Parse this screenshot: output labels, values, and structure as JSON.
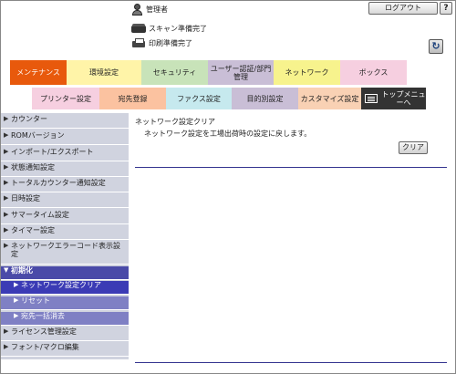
{
  "header": {
    "user_label": "管理者",
    "logout_label": "ログアウト",
    "help_label": "?",
    "scan_status": "スキャン準備完了",
    "print_status": "印刷準備完了",
    "refresh_label": "↻"
  },
  "main_tabs": [
    {
      "label": "メンテナンス",
      "active": true
    },
    {
      "label": "環境設定"
    },
    {
      "label": "セキュリティ"
    },
    {
      "label": "ユーザー認証/部門管理"
    },
    {
      "label": "ネットワーク"
    },
    {
      "label": "ボックス"
    }
  ],
  "sub_tabs": [
    {
      "label": "プリンター設定"
    },
    {
      "label": "宛先登録"
    },
    {
      "label": "ファクス設定"
    },
    {
      "label": "目的別設定"
    },
    {
      "label": "カスタマイズ設定"
    },
    {
      "label": "トップメニューへ"
    }
  ],
  "sidebar": {
    "items": [
      {
        "label": "カウンター",
        "mark": "▶"
      },
      {
        "label": "ROMバージョン",
        "mark": "▶"
      },
      {
        "label": "インポート/エクスポート",
        "mark": "▶"
      },
      {
        "label": "状態通知設定",
        "mark": "▶"
      },
      {
        "label": "トータルカウンター通知設定",
        "mark": "▶"
      },
      {
        "label": "日時設定",
        "mark": "▶"
      },
      {
        "label": "サマータイム設定",
        "mark": "▶"
      },
      {
        "label": "タイマー設定",
        "mark": "▶"
      },
      {
        "label": "ネットワークエラーコード表示設定",
        "mark": "▶"
      },
      {
        "label": "初期化",
        "mark": "▼"
      },
      {
        "label": "ネットワーク設定クリア",
        "mark": "▶"
      },
      {
        "label": "リセット",
        "mark": "▶"
      },
      {
        "label": "宛先一括消去",
        "mark": "▶"
      },
      {
        "label": "ライセンス管理設定",
        "mark": "▶"
      },
      {
        "label": "フォント/マクロ編集",
        "mark": "▶"
      }
    ]
  },
  "content": {
    "title": "ネットワーク設定クリア",
    "description": "ネットワーク設定を工場出荷時の設定に戻します。",
    "clear_button": "クリア"
  },
  "colors": {
    "maintenance_tab": "#e8590c",
    "sidebar_bg": "#d0d3df",
    "sidebar_group": "#4a4aa8",
    "sidebar_active": "#3b3bb5",
    "divider": "#34348f"
  }
}
